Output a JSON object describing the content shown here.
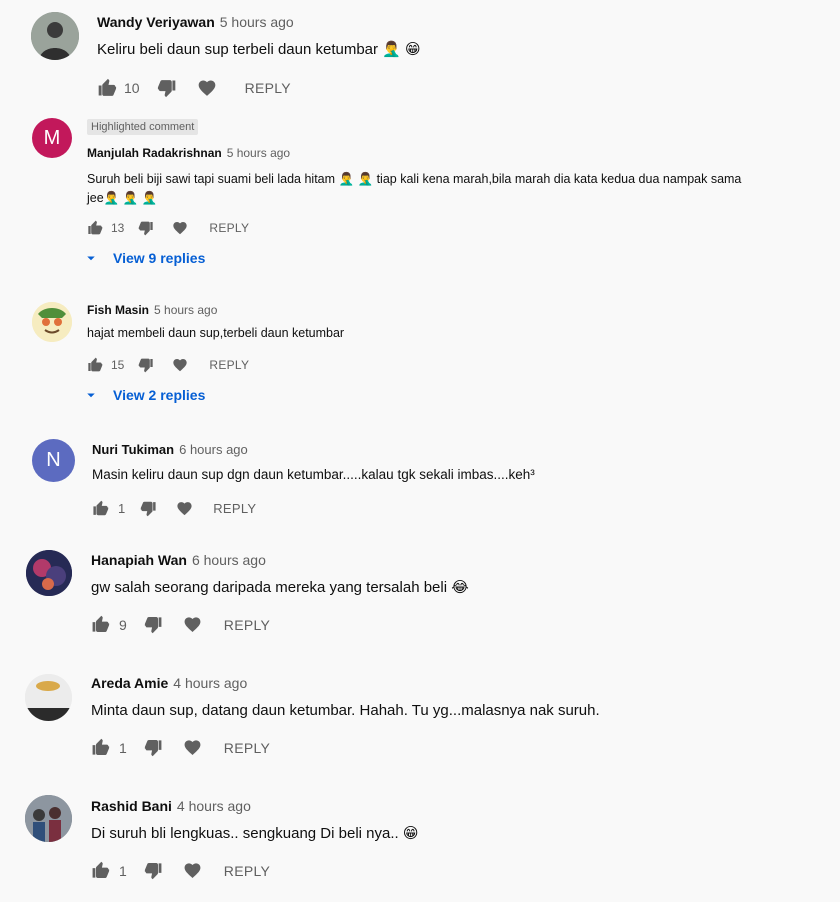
{
  "comments": [
    {
      "author": "Wandy Veriyawan",
      "time": "5 hours ago",
      "text": "Keliru beli daun sup terbeli daun ketumbar 🤦‍♂️ 😁",
      "likes": "10",
      "reply": "REPLY"
    },
    {
      "badge": "Highlighted comment",
      "author": "Manjulah Radakrishnan",
      "time": "5 hours ago",
      "avatar_letter": "M",
      "text_line1": "Suruh beli biji sawi tapi suami beli lada hitam 🤦‍♂️ 🤦‍♂️ tiap kali kena marah,bila marah dia kata kedua dua nampak sama",
      "text_line2": "jee🤦‍♂️ 🤦‍♂️ 🤦‍♂️",
      "likes": "13",
      "reply": "REPLY",
      "view_replies": "View 9 replies"
    },
    {
      "author": "Fish Masin",
      "time": "5 hours ago",
      "text": "hajat membeli daun sup,terbeli daun ketumbar",
      "likes": "15",
      "reply": "REPLY",
      "view_replies": "View 2 replies"
    },
    {
      "author": "Nuri Tukiman",
      "time": "6 hours ago",
      "avatar_letter": "N",
      "text": "Masin keliru daun sup dgn daun ketumbar.....kalau tgk sekali imbas....keh³",
      "likes": "1",
      "reply": "REPLY"
    },
    {
      "author": "Hanapiah Wan",
      "time": "6 hours ago",
      "text": "gw salah seorang daripada mereka yang tersalah beli 😂",
      "likes": "9",
      "reply": "REPLY"
    },
    {
      "author": "Areda Amie",
      "time": "4 hours ago",
      "text": "Minta daun sup, datang daun ketumbar. Hahah. Tu yg...malasnya nak suruh.",
      "likes": "1",
      "reply": "REPLY"
    },
    {
      "author": "Rashid Bani",
      "time": "4 hours ago",
      "text": "Di suruh bli lengkuas.. sengkuang Di beli nya.. 😁",
      "likes": "1",
      "reply": "REPLY"
    }
  ],
  "colors": {
    "avatar_m": "#c2185b",
    "avatar_n": "#5c6bc0",
    "link": "#065fd4",
    "secondary_text": "#606060"
  }
}
